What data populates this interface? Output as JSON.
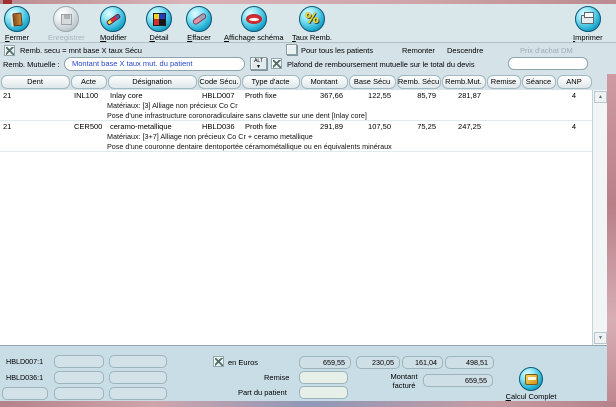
{
  "colors": {
    "accent_blue": "#22aed2",
    "panel": "#d5e3e8",
    "footer_panel": "#c9dde6",
    "pink_edge": "#c08890",
    "combo_text": "#2a46c8"
  },
  "toolbar": {
    "buttons": [
      {
        "label": "Fermer",
        "icon": "door-icon",
        "disabled": false
      },
      {
        "label": "Enregistrer",
        "icon": "save-icon",
        "disabled": true
      },
      {
        "label": "Modifier",
        "icon": "pencil-icon",
        "disabled": false
      },
      {
        "label": "Détail",
        "icon": "mosaic-icon",
        "disabled": false
      },
      {
        "label": "Effacer",
        "icon": "eraser-icon",
        "disabled": false
      },
      {
        "label": "Affichage schéma",
        "icon": "mouth-icon",
        "disabled": false
      },
      {
        "label": "Taux Remb.",
        "icon": "percent-icon",
        "disabled": false
      },
      {
        "label": "Imprimer",
        "icon": "printer-icon",
        "disabled": false
      }
    ]
  },
  "options": {
    "remb_secu_label": "Remb. secu = mnt base X taux Sécu",
    "pour_tous_label": "Pour tous les patients",
    "remonter_label": "Remonter",
    "descendre_label": "Descendre",
    "prix_achat_label": "Prix d'achat DM",
    "prix_achat_value": "",
    "remb_mutuelle_label": "Remb. Mutuelle :",
    "remb_mutuelle_value": "Montant base X taux mut. du patient",
    "alt_button_label": "ALT",
    "alt_button_arrow": "▼",
    "plafond_label": "Plafond de remboursement mutuelle sur le total du devis"
  },
  "table": {
    "columns": [
      "Dent",
      "Acte",
      "Désignation",
      "Code Sécu.",
      "Type d'acte",
      "Montant",
      "Base Sécu",
      "Remb. Sécu",
      "Remb.Mut.",
      "Remise",
      "Séance",
      "ANP"
    ],
    "rows": [
      {
        "dent": "21",
        "acte": "INL100",
        "designation": "Inlay core",
        "code": "HBLD007",
        "type": "Proth fixe",
        "montant": "367,66",
        "base": "122,55",
        "remb_secu": "85,79",
        "remb_mut": "281,87",
        "remise": "",
        "seance": "",
        "anp": "4",
        "materiaux": "Matériaux: [3] Alliage non précieux Co Cr",
        "description": "Pose d'une infrastructure coronoradiculaire sans clavette sur une dent [Inlay core]"
      },
      {
        "dent": "21",
        "acte": "CER500",
        "designation": "ceramo-metallique",
        "code": "HBLD036",
        "type": "Proth fixe",
        "montant": "291,89",
        "base": "107,50",
        "remb_secu": "75,25",
        "remb_mut": "247,25",
        "remise": "",
        "seance": "",
        "anp": "4",
        "materiaux": "Matériaux: [3+7] Alliage non précieux Co Cr + ceramo metallique",
        "description": "Pose d'une couronne dentaire dentoportée céramométallique ou en équivalents minéraux"
      }
    ],
    "scroll_up": "▲",
    "scroll_down": "▼"
  },
  "footer": {
    "codes": [
      {
        "c1": "HBLD007:1",
        "c2": "",
        "c3": ""
      },
      {
        "c1": "HBLD036:1",
        "c2": "",
        "c3": ""
      },
      {
        "c1": "",
        "c2": "",
        "c3": ""
      }
    ],
    "en_euros_label": "en Euros",
    "totals": {
      "montant": "659,55",
      "base": "230,05",
      "remb_secu": "161,04",
      "remb_mut": "498,51"
    },
    "remise_label": "Remise",
    "remise_value": "",
    "part_patient_label": "Part du patient",
    "part_patient_value": "",
    "montant_facture_label": "Montant facturé",
    "montant_facture_value": "659,55",
    "calcul_complet_label": "Calcul Complet"
  }
}
